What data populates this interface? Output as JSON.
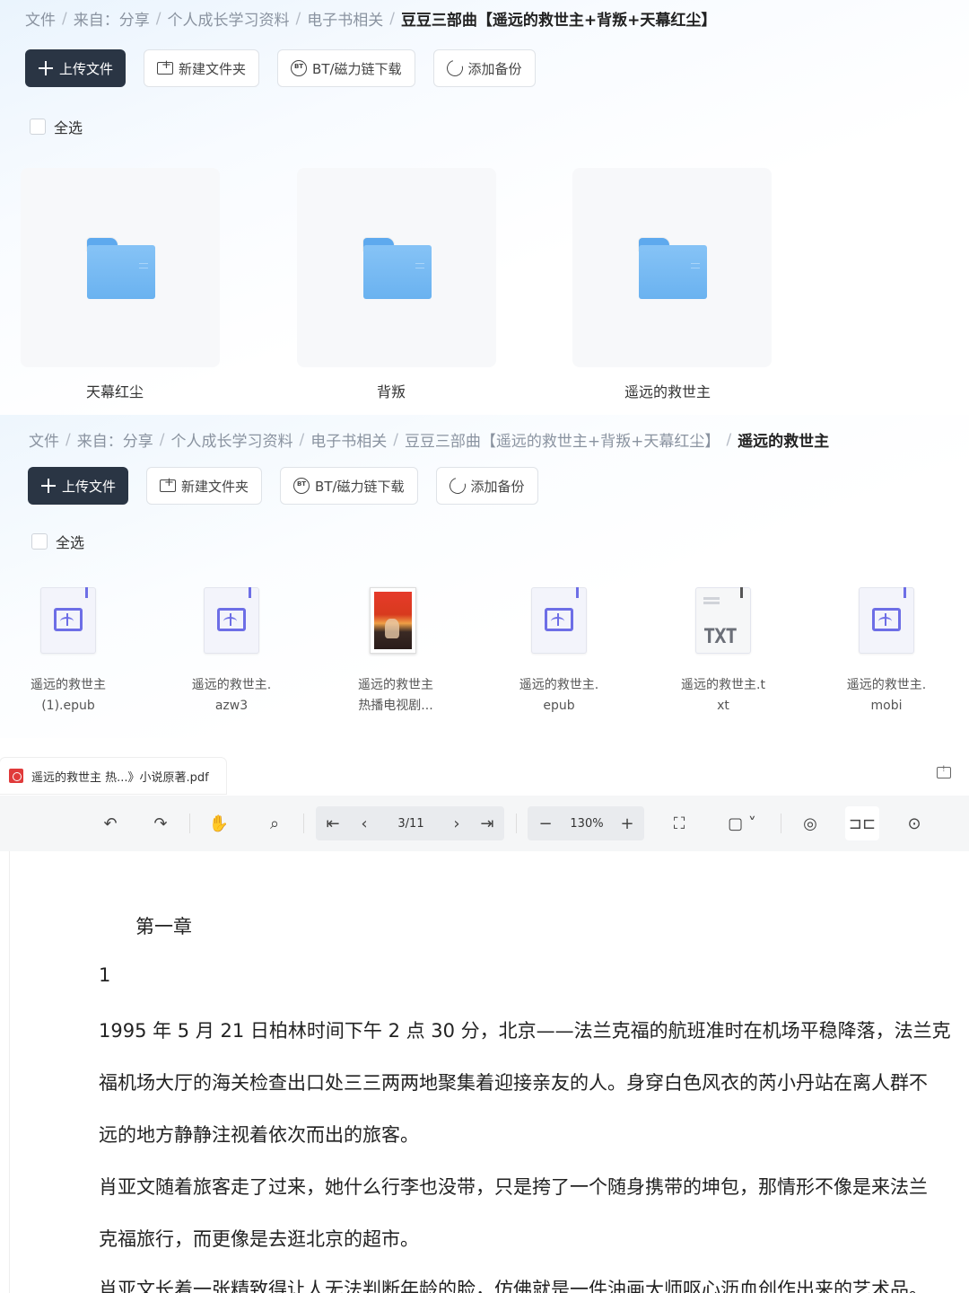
{
  "panel1": {
    "breadcrumb": [
      "文件",
      "来自：分享",
      "个人成长学习资料",
      "电子书相关",
      "豆豆三部曲【遥远的救世主+背叛+天幕红尘】"
    ],
    "buttons": {
      "upload": "上传文件",
      "new_folder": "新建文件夹",
      "bt": "BT/磁力链下载",
      "backup": "添加备份"
    },
    "select_all": "全选",
    "folders": [
      "天幕红尘",
      "背叛",
      "遥远的救世主"
    ]
  },
  "panel2": {
    "breadcrumb": [
      "文件",
      "来自：分享",
      "个人成长学习资料",
      "电子书相关",
      "豆豆三部曲【遥远的救世主+背叛+天幕红尘】",
      "遥远的救世主"
    ],
    "buttons": {
      "upload": "上传文件",
      "new_folder": "新建文件夹",
      "bt": "BT/磁力链下载",
      "backup": "添加备份"
    },
    "select_all": "全选",
    "files": [
      {
        "line1": "遥远的救世主",
        "line2": "(1).epub",
        "icon": "ebook-icon"
      },
      {
        "line1": "遥远的救世主.",
        "line2": "azw3",
        "icon": "ebook-icon"
      },
      {
        "line1": "遥远的救世主",
        "line2": "热播电视剧...",
        "icon": "pdf-cover-thumbnail"
      },
      {
        "line1": "遥远的救世主.",
        "line2": "epub",
        "icon": "ebook-icon"
      },
      {
        "line1": "遥远的救世主.t",
        "line2": "xt",
        "icon": "txt-file-icon",
        "icon_label": "TXT"
      },
      {
        "line1": "遥远的救世主.",
        "line2": "mobi",
        "icon": "ebook-icon"
      }
    ]
  },
  "viewer": {
    "tab_title": "遥远的救世主 热...》小说原著.pdf",
    "page_indicator": "3/11",
    "zoom": "130%",
    "content": [
      "第一章",
      "1",
      "1995 年 5 月 21 日柏林时间下午 2 点 30 分，北京——法兰克福的航班准时在机场平稳降落，法兰克",
      "福机场大厅的海关检查出口处三三两两地聚集着迎接亲友的人。身穿白色风衣的芮小丹站在离人群不",
      "远的地方静静注视着依次而出的旅客。",
      "肖亚文随着旅客走了过来，她什么行李也没带，只是挎了一个随身携带的坤包，那情形不像是来法兰",
      "克福旅行，而更像是去逛北京的超市。",
      "肖亚文长着一张精致得让人无法判断年龄的脸，仿佛就是一件油画大师呕心沥血创作出来的艺术品。"
    ]
  },
  "colors": {
    "primary_button": "#2a3544",
    "folder_blue": "#6ab2f0",
    "ebook_accent": "#6d6ee6",
    "pdf_red": "#e03a3a"
  }
}
